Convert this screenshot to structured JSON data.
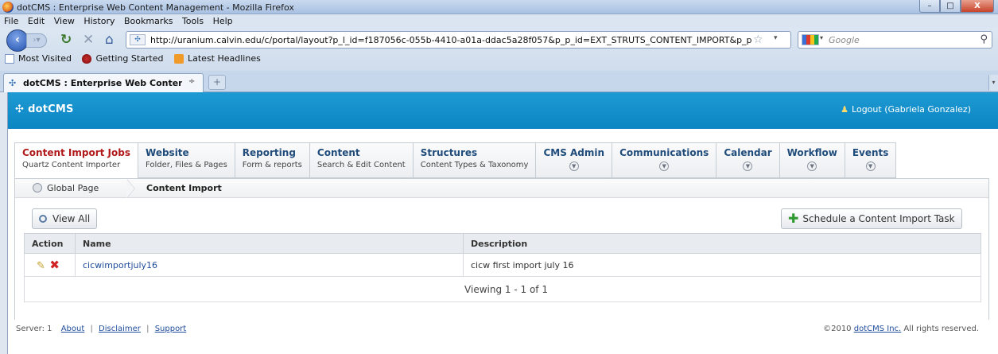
{
  "window": {
    "title": "dotCMS : Enterprise Web Content Management - Mozilla Firefox",
    "minimize": "–",
    "maximize": "□",
    "close": "X"
  },
  "menu": {
    "file": "File",
    "edit": "Edit",
    "view": "View",
    "history": "History",
    "bookmarks": "Bookmarks",
    "tools": "Tools",
    "help": "Help"
  },
  "toolbar": {
    "url": "http://uranium.calvin.edu/c/portal/layout?p_l_id=f187056c-055b-4410-a01a-ddac5a28f057&p_p_id=EXT_STRUTS_CONTENT_IMPORT&p_p_a",
    "search_placeholder": "Google"
  },
  "bookmarks_bar": [
    "Most Visited",
    "Getting Started",
    "Latest Headlines"
  ],
  "browser_tab": {
    "title": "dotCMS : Enterprise Web Content Ma...",
    "close": "÷",
    "new_tab": "+"
  },
  "app": {
    "logo": "dotCMS",
    "logout": "Logout (Gabriela Gonzalez)"
  },
  "nav_tabs": [
    {
      "title": "Content Import Jobs",
      "subtitle": "Quartz Content Importer",
      "active": true
    },
    {
      "title": "Website",
      "subtitle": "Folder, Files & Pages"
    },
    {
      "title": "Reporting",
      "subtitle": "Form & reports"
    },
    {
      "title": "Content",
      "subtitle": "Search & Edit Content"
    },
    {
      "title": "Structures",
      "subtitle": "Content Types & Taxonomy"
    },
    {
      "title": "CMS Admin",
      "dropdown": true
    },
    {
      "title": "Communications",
      "dropdown": true
    },
    {
      "title": "Calendar",
      "dropdown": true
    },
    {
      "title": "Workflow",
      "dropdown": true
    },
    {
      "title": "Events",
      "dropdown": true
    }
  ],
  "breadcrumb": {
    "root": "Global Page",
    "current": "Content Import"
  },
  "actions": {
    "view_all": "View All",
    "schedule": "Schedule a Content Import Task"
  },
  "table": {
    "headers": {
      "action": "Action",
      "name": "Name",
      "description": "Description"
    },
    "rows": [
      {
        "name": "cicwimportjuly16",
        "description": "cicw first import july 16"
      }
    ],
    "pagination": "Viewing 1 - 1 of 1"
  },
  "footer": {
    "server": "Server: 1",
    "about": "About",
    "disclaimer": "Disclaimer",
    "support": "Support",
    "copyright_prefix": "©2010",
    "company": "dotCMS Inc.",
    "copyright_suffix": "All rights reserved."
  }
}
